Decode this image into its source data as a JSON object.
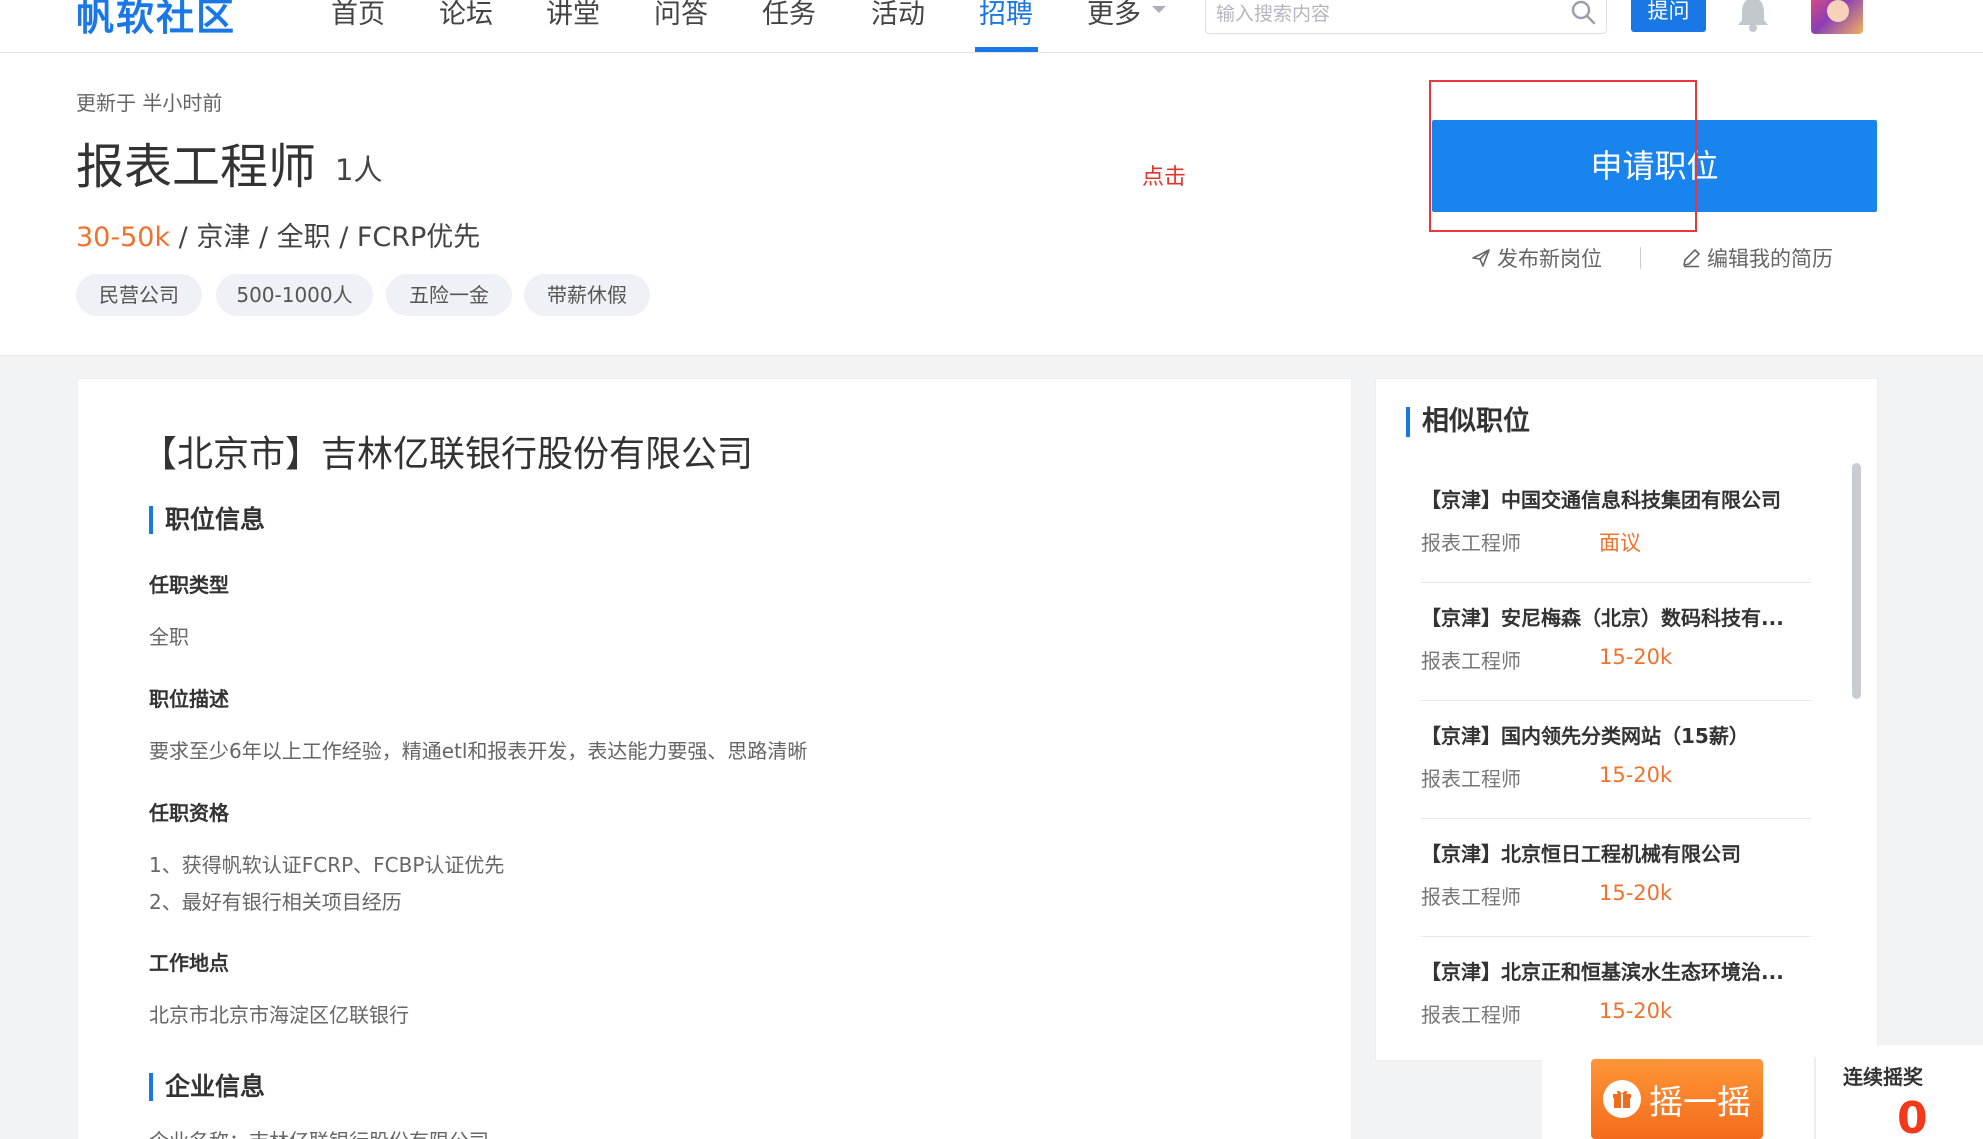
{
  "nav": {
    "logo": "帆软社区",
    "items": [
      {
        "label": "首页",
        "active": false
      },
      {
        "label": "论坛",
        "active": false
      },
      {
        "label": "讲堂",
        "active": false
      },
      {
        "label": "问答",
        "active": false
      },
      {
        "label": "任务",
        "active": false
      },
      {
        "label": "活动",
        "active": false
      },
      {
        "label": "招聘",
        "active": true
      },
      {
        "label": "更多",
        "active": false
      }
    ],
    "search_placeholder": "输入搜索内容",
    "ask_label": "提问"
  },
  "job": {
    "updated": "更新于 半小时前",
    "title": "报表工程师",
    "count": "1人",
    "salary": "30-50k",
    "meta": " / 京津 / 全职 / FCRP优先",
    "tags": [
      "民营公司",
      "500-1000人",
      "五险一金",
      "带薪休假"
    ],
    "click_hint": "点击",
    "apply_label": "申请职位",
    "post_new_label": "发布新岗位",
    "edit_resume_label": "编辑我的简历"
  },
  "detail": {
    "company_title": "【北京市】吉林亿联银行股份有限公司",
    "section_job_info": "职位信息",
    "type_label": "任职类型",
    "type_value": "全职",
    "desc_label": "职位描述",
    "desc_value": "要求至少6年以上工作经验，精通etl和报表开发，表达能力要强、思路清晰",
    "qual_label": "任职资格",
    "qual_lines": [
      "1、获得帆软认证FCRP、FCBP认证优先",
      "2、最好有银行相关项目经历"
    ],
    "location_label": "工作地点",
    "location_value": "北京市北京市海淀区亿联银行",
    "section_company_info": "企业信息",
    "company_name_line": "企业名称：吉林亿联银行股份有限公司"
  },
  "similar": {
    "title": "相似职位",
    "items": [
      {
        "name": "【京津】中国交通信息科技集团有限公司",
        "role": "报表工程师",
        "salary": "面议"
      },
      {
        "name": "【京津】安尼梅森（北京）数码科技有...",
        "role": "报表工程师",
        "salary": "15-20k"
      },
      {
        "name": "【京津】国内领先分类网站（15薪）",
        "role": "报表工程师",
        "salary": "15-20k"
      },
      {
        "name": "【京津】北京恒日工程机械有限公司",
        "role": "报表工程师",
        "salary": "15-20k"
      },
      {
        "name": "【京津】北京正和恒基滨水生态环境治...",
        "role": "报表工程师",
        "salary": "15-20k"
      }
    ]
  },
  "shake": {
    "button_label": "摇一摇",
    "streak_label": "连续摇奖",
    "streak_count": "0"
  },
  "colors": {
    "brand": "#1a78e6",
    "salary": "#f2722c",
    "highlight": "#e8383d"
  }
}
